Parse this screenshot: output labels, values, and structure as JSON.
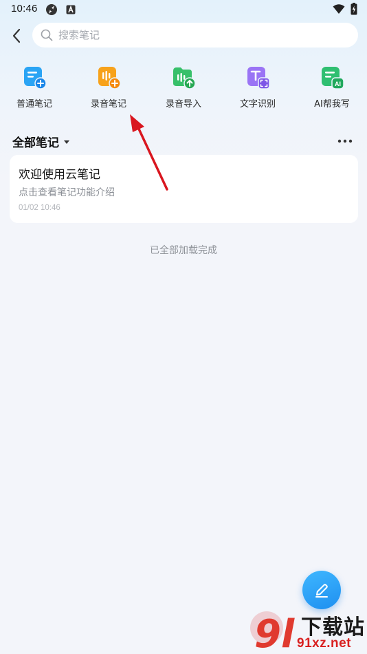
{
  "status_bar": {
    "time": "10:46",
    "left_icons": [
      "network-activity-icon",
      "keyboard-a-icon"
    ],
    "right_icons": [
      "wifi-icon",
      "battery-charging-icon"
    ]
  },
  "header": {
    "search_placeholder": "搜索笔记"
  },
  "quick_actions": [
    {
      "label": "普通笔记",
      "icon": "note-add-icon",
      "color": "#2aa4f4"
    },
    {
      "label": "录音笔记",
      "icon": "audio-note-add-icon",
      "color": "#f7a21b"
    },
    {
      "label": "录音导入",
      "icon": "audio-import-icon",
      "color": "#37c06a"
    },
    {
      "label": "文字识别",
      "icon": "text-recognition-icon",
      "color": "#8e67f0"
    },
    {
      "label": "AI帮我写",
      "icon": "ai-write-icon",
      "color": "#2fbf71"
    }
  ],
  "section": {
    "title": "全部笔记"
  },
  "notes": [
    {
      "title": "欢迎使用云笔记",
      "summary": "点击查看笔记功能介绍",
      "time": "01/02 10:46"
    }
  ],
  "list_footer": "已全部加载完成",
  "colors": {
    "accent": "#1e8ff0",
    "annotation_arrow": "#d9161f"
  },
  "watermark": {
    "logo_text": "9l",
    "site_cn": "下载站",
    "site_domain": "91xz.net"
  }
}
